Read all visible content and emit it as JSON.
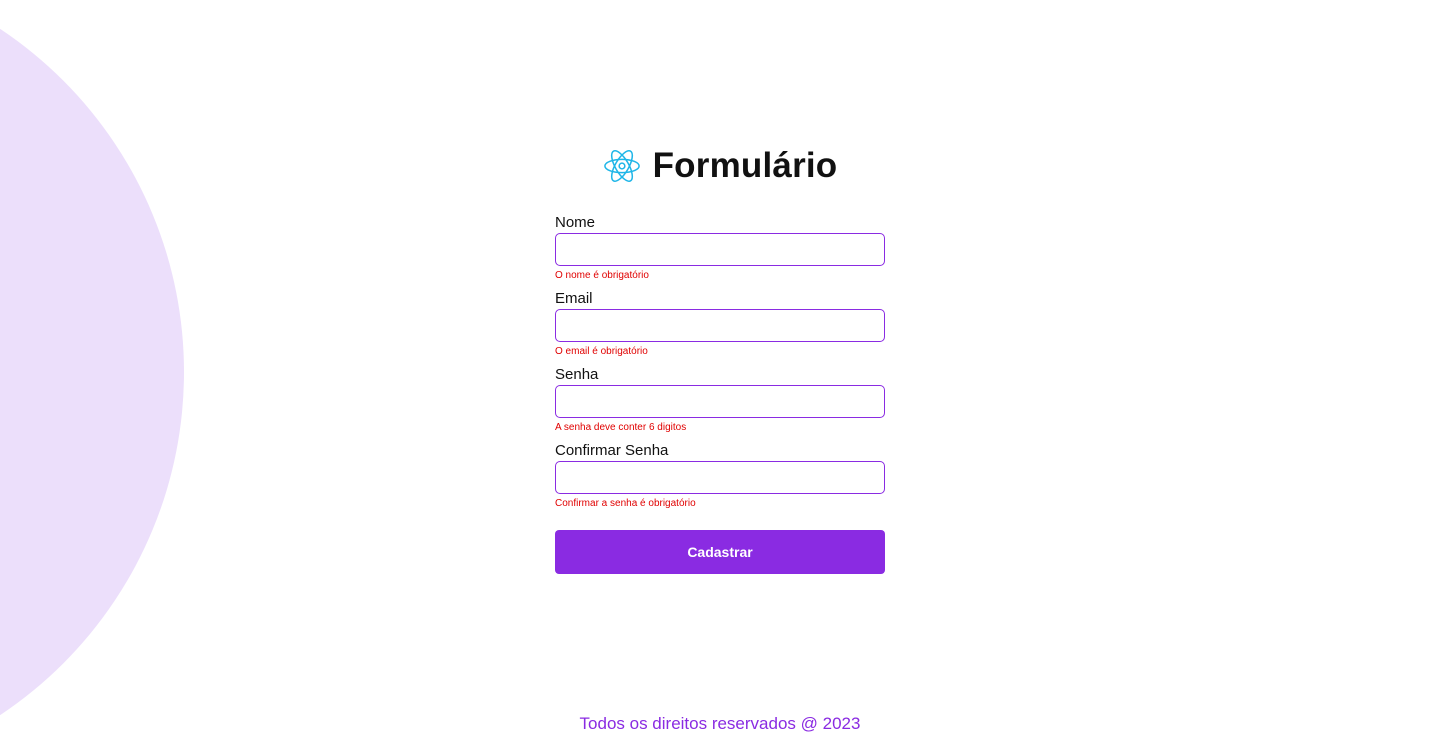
{
  "header": {
    "title": "Formulário",
    "logo_icon": "react-atom-icon"
  },
  "form": {
    "fields": [
      {
        "label": "Nome",
        "value": "",
        "error": "O nome é obrigatório"
      },
      {
        "label": "Email",
        "value": "",
        "error": "O email é obrigatório"
      },
      {
        "label": "Senha",
        "value": "",
        "error": "A senha deve conter 6 digitos"
      },
      {
        "label": "Confirmar Senha",
        "value": "",
        "error": "Confirmar a senha é obrigatório"
      }
    ],
    "submit_label": "Cadastrar"
  },
  "footer": {
    "text": "Todos os direitos reservados @ 2023"
  },
  "colors": {
    "accent": "#8a2be2",
    "error": "#e00000",
    "background_circle": "#ecdffb",
    "logo": "#1fb6e8"
  }
}
